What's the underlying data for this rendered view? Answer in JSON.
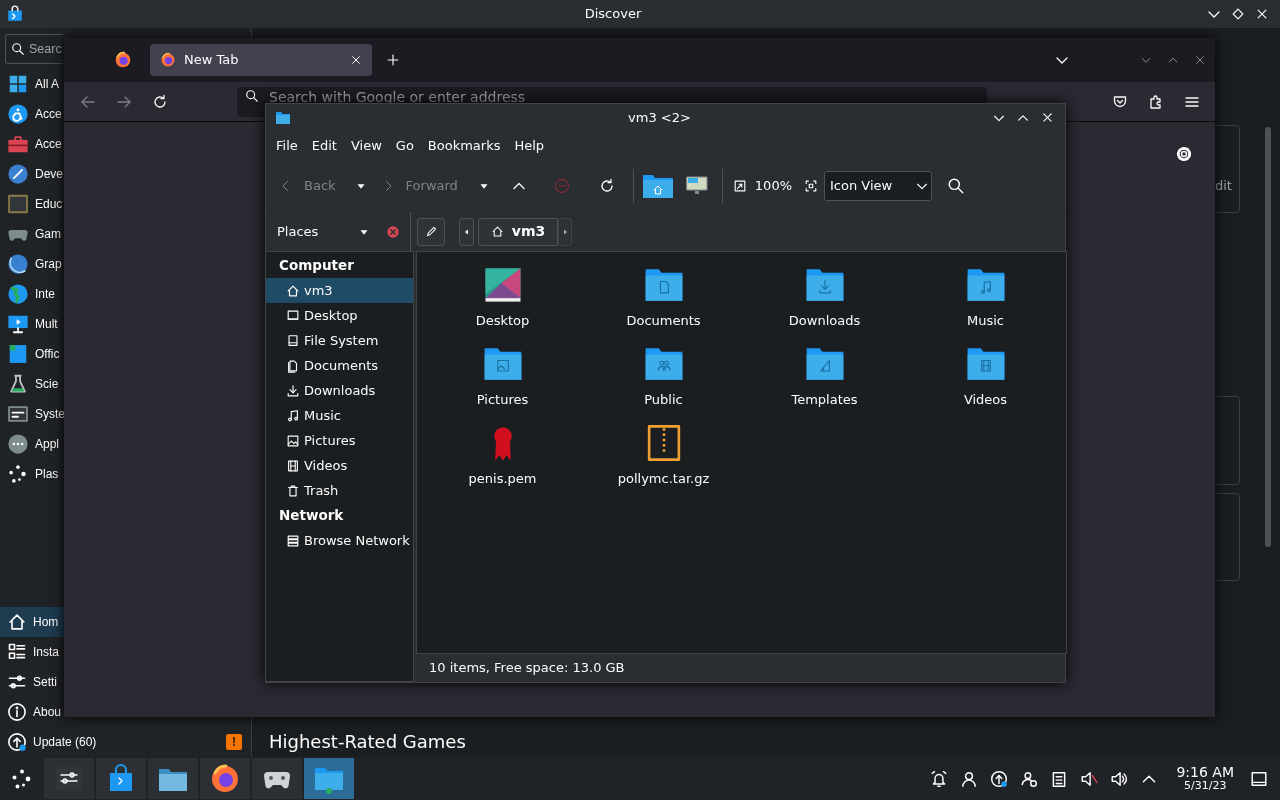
{
  "discover": {
    "title": "Discover",
    "search": {
      "placeholder": "Searc"
    },
    "categories": [
      {
        "label": "All A",
        "kind": "grid"
      },
      {
        "label": "Acce",
        "kind": "access"
      },
      {
        "label": "Acce",
        "kind": "toolbox"
      },
      {
        "label": "Deve",
        "kind": "pen"
      },
      {
        "label": "Educ",
        "kind": "board"
      },
      {
        "label": "Gam",
        "kind": "gamepad"
      },
      {
        "label": "Grap",
        "kind": "ball"
      },
      {
        "label": "Inte",
        "kind": "globe"
      },
      {
        "label": "Mult",
        "kind": "monitor"
      },
      {
        "label": "Offic",
        "kind": "office"
      },
      {
        "label": "Scie",
        "kind": "flask"
      },
      {
        "label": "Syste",
        "kind": "panel"
      },
      {
        "label": "Appl",
        "kind": "more"
      },
      {
        "label": "Plas",
        "kind": "dots"
      }
    ],
    "nav": [
      {
        "label": "Hom",
        "kind": "home",
        "selected": true
      },
      {
        "label": "Insta",
        "kind": "list",
        "selected": false
      },
      {
        "label": "Setti",
        "kind": "sliders",
        "selected": false
      },
      {
        "label": "Abou",
        "kind": "info",
        "selected": false
      }
    ],
    "update": {
      "label": "Update (60)",
      "badge": "!"
    },
    "card_text": "dit",
    "section_title": "Highest-Rated Games"
  },
  "browser": {
    "tabs": [
      {
        "label": "New Tab",
        "selected": true
      }
    ],
    "address": {
      "placeholder": "Search with Google or enter address"
    }
  },
  "file_manager": {
    "title": "vm3 <2>",
    "menu": [
      "File",
      "Edit",
      "View",
      "Go",
      "Bookmarks",
      "Help"
    ],
    "toolbar": {
      "back": {
        "label": "Back",
        "disabled": true
      },
      "forward": {
        "label": "Forward",
        "disabled": true
      },
      "stop": {
        "disabled": true
      },
      "zoom": "100%",
      "view_mode": "Icon View"
    },
    "places_label": "Places",
    "breadcrumb": "vm3",
    "places": [
      {
        "heading": "Computer",
        "items": [
          {
            "label": "vm3",
            "kind": "home",
            "selected": true
          },
          {
            "label": "Desktop",
            "kind": "monitor",
            "selected": false
          },
          {
            "label": "File System",
            "kind": "drive",
            "selected": false
          },
          {
            "label": "Documents",
            "kind": "document",
            "selected": false
          },
          {
            "label": "Downloads",
            "kind": "download",
            "selected": false
          },
          {
            "label": "Music",
            "kind": "music",
            "selected": false
          },
          {
            "label": "Pictures",
            "kind": "picture",
            "selected": false
          },
          {
            "label": "Videos",
            "kind": "film",
            "selected": false
          },
          {
            "label": "Trash",
            "kind": "trash",
            "selected": false
          }
        ]
      },
      {
        "heading": "Network",
        "items": [
          {
            "label": "Browse Network",
            "kind": "network",
            "selected": false
          }
        ]
      }
    ],
    "files": [
      {
        "name": "Desktop",
        "kind": "wallpaper"
      },
      {
        "name": "Documents",
        "kind": "documents"
      },
      {
        "name": "Downloads",
        "kind": "downloads"
      },
      {
        "name": "Music",
        "kind": "music"
      },
      {
        "name": "Pictures",
        "kind": "pictures"
      },
      {
        "name": "Public",
        "kind": "public"
      },
      {
        "name": "Templates",
        "kind": "templates"
      },
      {
        "name": "Videos",
        "kind": "videos"
      },
      {
        "name": "penis.pem",
        "kind": "certificate"
      },
      {
        "name": "pollymc.tar.gz",
        "kind": "archive"
      }
    ],
    "status": "10 items, Free space: 13.0 GB"
  },
  "taskbar": {
    "tasks": [
      {
        "kind": "mixer",
        "active": false
      },
      {
        "kind": "store",
        "active": false
      },
      {
        "kind": "folder",
        "active": false
      },
      {
        "kind": "browser",
        "active": false
      },
      {
        "kind": "gamepad",
        "active": false
      },
      {
        "kind": "newfolder",
        "active": true
      }
    ],
    "clock": {
      "time": "9:16 AM",
      "date": "5/31/23"
    }
  }
}
